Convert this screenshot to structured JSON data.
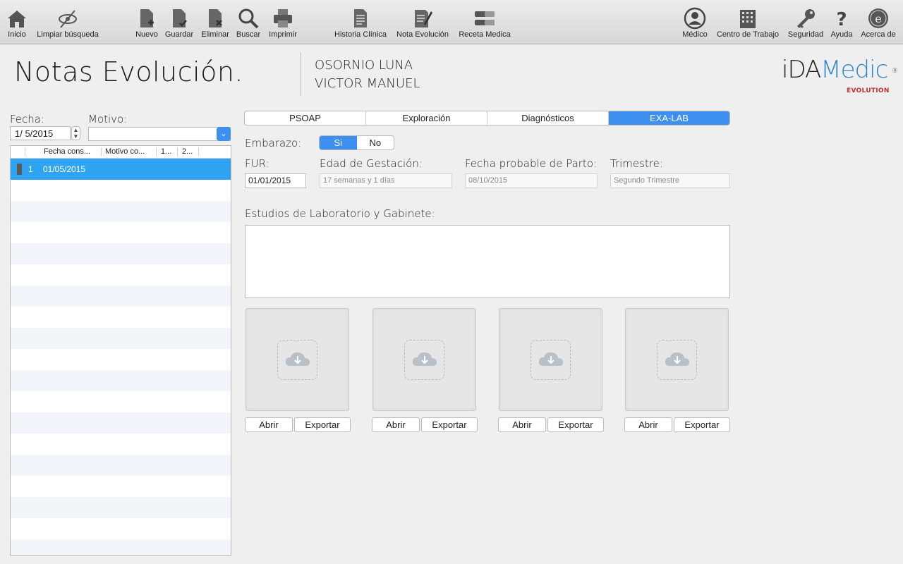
{
  "toolbar": {
    "left": [
      {
        "label": "Inicio",
        "icon": "home-icon"
      },
      {
        "label": "Limpiar búsqueda",
        "icon": "clear-search-icon"
      },
      {
        "label": "Nuevo",
        "icon": "new-document-icon"
      },
      {
        "label": "Guardar",
        "icon": "save-document-icon"
      },
      {
        "label": "Eliminar",
        "icon": "delete-document-icon"
      },
      {
        "label": "Buscar",
        "icon": "search-icon"
      },
      {
        "label": "Imprimir",
        "icon": "printer-icon"
      },
      {
        "label": "Historia Clínica",
        "icon": "clinical-history-icon"
      },
      {
        "label": "Nota Evolución",
        "icon": "evolution-note-icon"
      },
      {
        "label": "Receta Medica",
        "icon": "prescription-icon"
      }
    ],
    "right": [
      {
        "label": "Médico",
        "icon": "doctor-icon"
      },
      {
        "label": "Centro de Trabajo",
        "icon": "building-icon"
      },
      {
        "label": "Seguridad",
        "icon": "key-icon"
      },
      {
        "label": "Ayuda",
        "icon": "help-icon"
      },
      {
        "label": "Acerca de",
        "icon": "about-icon"
      }
    ]
  },
  "header": {
    "title": "Notas Evolución.",
    "patient_line1": "OSORNIO LUNA",
    "patient_line2": "VICTOR MANUEL",
    "logo_prefix": "iDA",
    "logo_accent": "Medic",
    "logo_reg": "®",
    "logo_sub": "EVOLUTION"
  },
  "filters": {
    "fecha_label": "Fecha:",
    "fecha_value": "1/  5/2015",
    "motivo_label": "Motivo:",
    "motivo_value": ""
  },
  "notes_table": {
    "columns": [
      "Fecha cons...",
      "Motivo co...",
      "1...",
      "2..."
    ],
    "rows": [
      {
        "num": "1",
        "fecha": "01/05/2015",
        "selected": true
      }
    ]
  },
  "tabs": [
    {
      "label": "PSOAP",
      "active": false
    },
    {
      "label": "Exploración",
      "active": false
    },
    {
      "label": "Diagnósticos",
      "active": false
    },
    {
      "label": "EXA-LAB",
      "active": true
    }
  ],
  "embarazo": {
    "label": "Embarazo:",
    "options": [
      "Si",
      "No"
    ],
    "selected": "Si"
  },
  "pregnancy_fields": {
    "fur_label": "FUR:",
    "fur_value": "01/01/2015",
    "edad_label": "Edad de Gestación:",
    "edad_value": "17 semanas y 1 días",
    "parto_label": "Fecha probable de Parto:",
    "parto_value": "08/10/2015",
    "trimestre_label": "Trimestre:",
    "trimestre_value": "Segundo Trimestre"
  },
  "estudios": {
    "label": "Estudios de Laboratorio y Gabinete:",
    "value": ""
  },
  "image_slots": [
    {
      "open": "Abrir",
      "export": "Exportar"
    },
    {
      "open": "Abrir",
      "export": "Exportar"
    },
    {
      "open": "Abrir",
      "export": "Exportar"
    },
    {
      "open": "Abrir",
      "export": "Exportar"
    }
  ],
  "colors": {
    "accent": "#3d8ff0",
    "selection": "#2ea4f2",
    "logo_blue": "#2f86c8",
    "logo_red": "#c0302f"
  }
}
